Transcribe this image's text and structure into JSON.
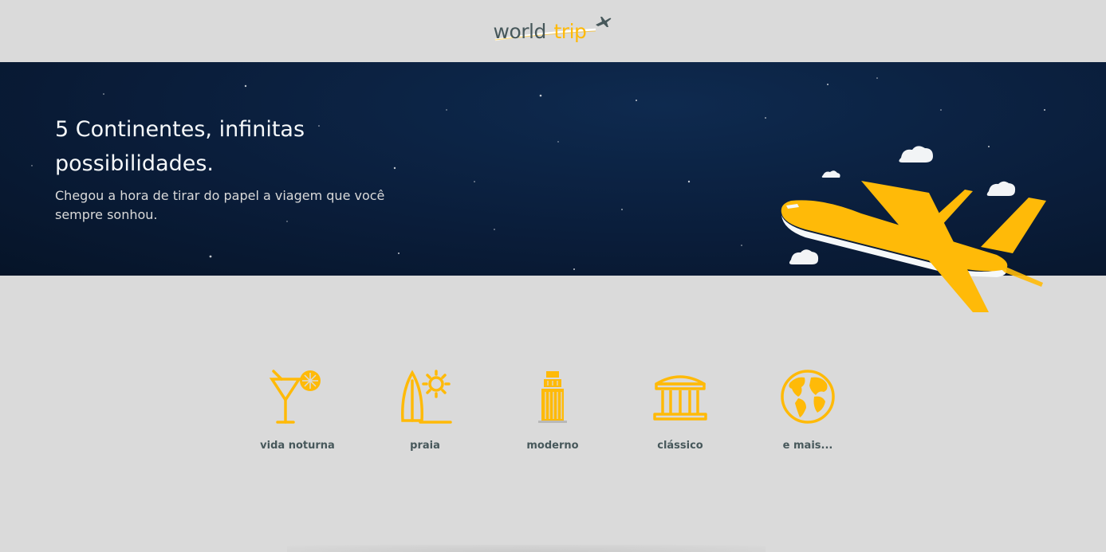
{
  "header": {
    "logo_world": "world",
    "logo_trip": "trip",
    "logo_icon": "airplane-icon"
  },
  "banner": {
    "title": "5 Continentes, infinitas possibilidades.",
    "subtitle": "Chegou a hora de tirar do papel a viagem que você sempre sonhou.",
    "illustration": "airplane-with-clouds"
  },
  "travel_types": [
    {
      "label": "vida noturna",
      "icon": "cocktail-icon"
    },
    {
      "label": "praia",
      "icon": "surfboard-sun-icon"
    },
    {
      "label": "moderno",
      "icon": "skyscraper-icon"
    },
    {
      "label": "clássico",
      "icon": "classical-building-icon"
    },
    {
      "label": "e mais...",
      "icon": "globe-icon"
    }
  ],
  "colors": {
    "background": "#dadada",
    "accent": "#ffba08",
    "text_dark": "#47585b",
    "banner_text": "#f5f8fa"
  }
}
